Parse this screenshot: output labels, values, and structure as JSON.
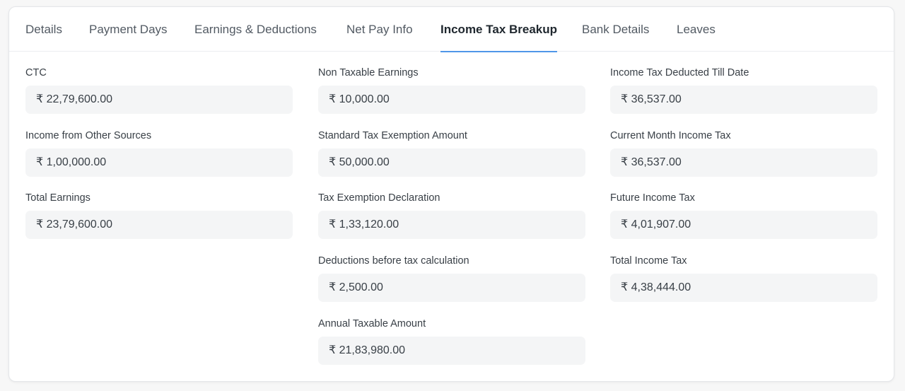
{
  "tabs": [
    {
      "label": "Details",
      "active": false
    },
    {
      "label": "Payment Days",
      "active": false
    },
    {
      "label": "Earnings & Deductions",
      "active": false
    },
    {
      "label": "Net Pay Info",
      "active": false
    },
    {
      "label": "Income Tax Breakup",
      "active": true
    },
    {
      "label": "Bank Details",
      "active": false
    },
    {
      "label": "Leaves",
      "active": false
    }
  ],
  "columns": {
    "col1": [
      {
        "label": "CTC",
        "value": "₹ 22,79,600.00"
      },
      {
        "label": "Income from Other Sources",
        "value": "₹ 1,00,000.00"
      },
      {
        "label": "Total Earnings",
        "value": "₹ 23,79,600.00"
      }
    ],
    "col2": [
      {
        "label": "Non Taxable Earnings",
        "value": "₹ 10,000.00"
      },
      {
        "label": "Standard Tax Exemption Amount",
        "value": "₹ 50,000.00"
      },
      {
        "label": "Tax Exemption Declaration",
        "value": "₹ 1,33,120.00"
      },
      {
        "label": "Deductions before tax calculation",
        "value": "₹ 2,500.00"
      },
      {
        "label": "Annual Taxable Amount",
        "value": "₹ 21,83,980.00"
      }
    ],
    "col3": [
      {
        "label": "Income Tax Deducted Till Date",
        "value": "₹ 36,537.00"
      },
      {
        "label": "Current Month Income Tax",
        "value": "₹ 36,537.00"
      },
      {
        "label": "Future Income Tax",
        "value": "₹ 4,01,907.00"
      },
      {
        "label": "Total Income Tax",
        "value": "₹ 4,38,444.00"
      }
    ]
  },
  "colors": {
    "active_tab_underline": "#4f96e8",
    "field_background": "#f4f5f6"
  }
}
